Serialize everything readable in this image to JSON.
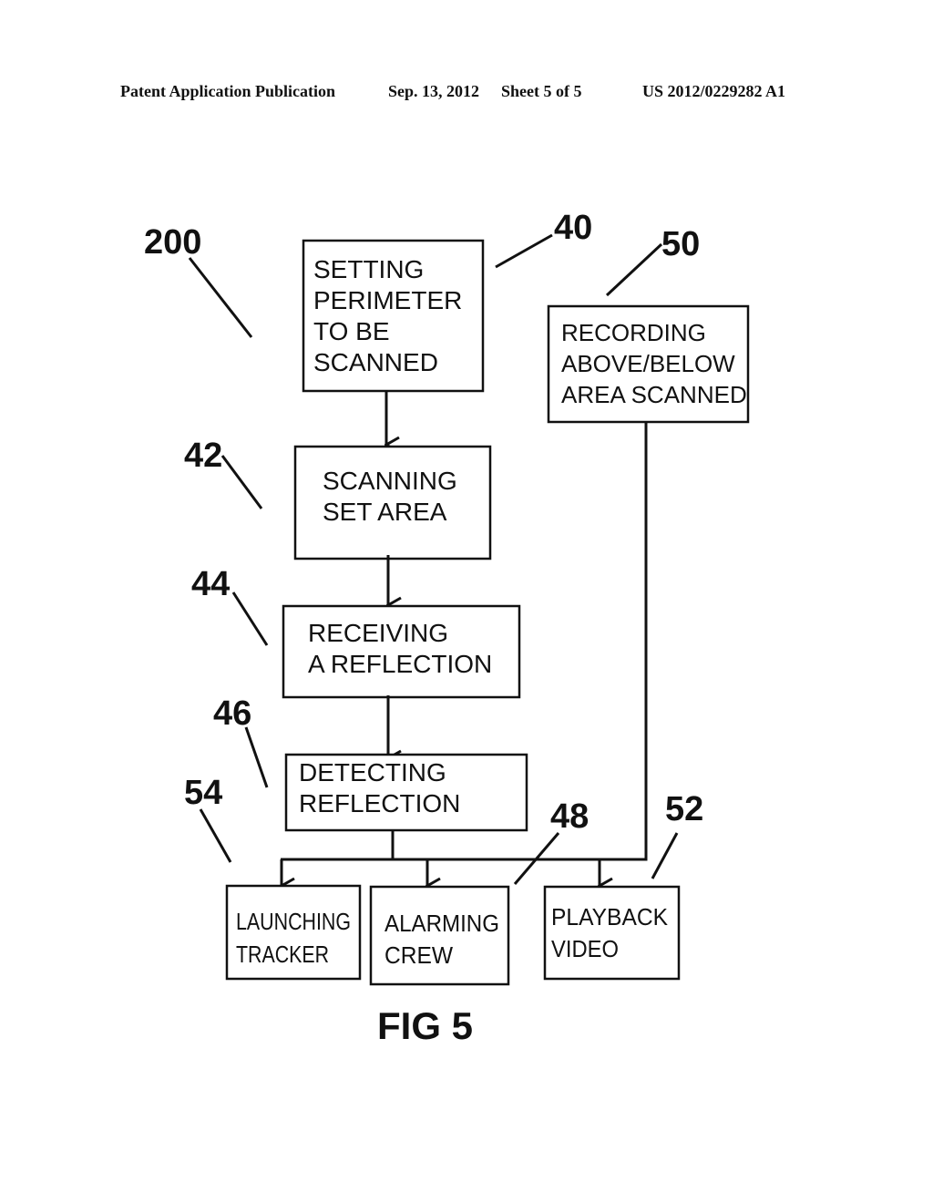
{
  "header": {
    "publication": "Patent Application Publication",
    "date": "Sep. 13, 2012",
    "sheet": "Sheet 5 of 5",
    "number": "US 2012/0229282 A1"
  },
  "figure": {
    "label": "FIG 5",
    "reference": "200",
    "steps": [
      {
        "ref": "40",
        "lines": [
          "SETTING",
          "PERIMETER",
          "TO BE",
          "SCANNED"
        ]
      },
      {
        "ref": "42",
        "lines": [
          "SCANNING",
          "SET AREA"
        ]
      },
      {
        "ref": "44",
        "lines": [
          "RECEIVING",
          "A REFLECTION"
        ]
      },
      {
        "ref": "46",
        "lines": [
          "DETECTING",
          "REFLECTION"
        ]
      },
      {
        "ref": "50",
        "lines": [
          "RECORDING",
          "ABOVE/BELOW",
          "AREA SCANNED"
        ]
      },
      {
        "ref": "54",
        "lines": [
          "LAUNCHING",
          "TRACKER"
        ]
      },
      {
        "ref": "48",
        "lines": [
          "ALARMING",
          "CREW"
        ]
      },
      {
        "ref": "52",
        "lines": [
          "PLAYBACK",
          "VIDEO"
        ]
      }
    ]
  }
}
